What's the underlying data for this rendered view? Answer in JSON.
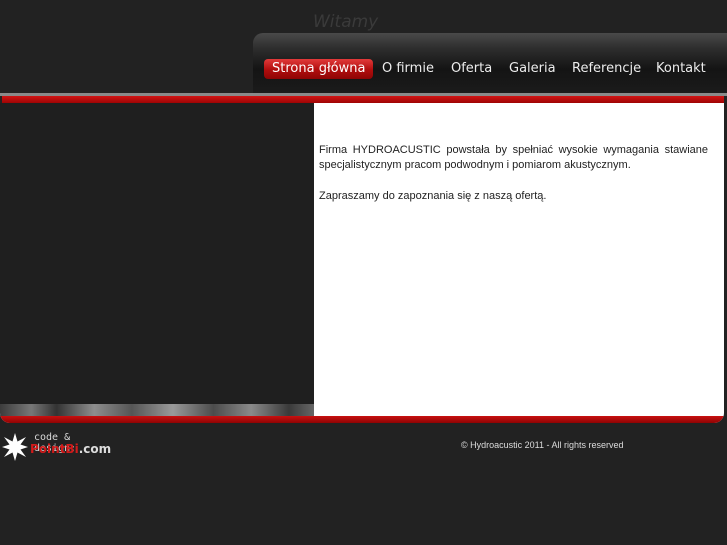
{
  "nav": {
    "items": [
      {
        "label": "Strona główna",
        "active": true
      },
      {
        "label": "O firmie",
        "active": false
      },
      {
        "label": "Oferta",
        "active": false
      },
      {
        "label": "Galeria",
        "active": false
      },
      {
        "label": "Referencje",
        "active": false
      },
      {
        "label": "Kontakt",
        "active": false
      }
    ]
  },
  "content": {
    "title": "Witamy",
    "paragraph1": "Firma HYDROACUSTIC powstała by spełniać wysokie wymagania stawiane specjalistycznym pracom podwodnym i pomiarom akustycznym.",
    "paragraph2": "Zapraszamy do zapoznania się z naszą ofertą."
  },
  "footer": {
    "credit_label": "code & design:",
    "credit_brand": "PointBi",
    "credit_suffix": ".com",
    "copyright": "© Hydroacustic 2011 - All rights reserved"
  },
  "colors": {
    "accent_red": "#c91010",
    "page_bg": "#222222"
  },
  "icons": {
    "credit_logo": "starburst-icon"
  }
}
